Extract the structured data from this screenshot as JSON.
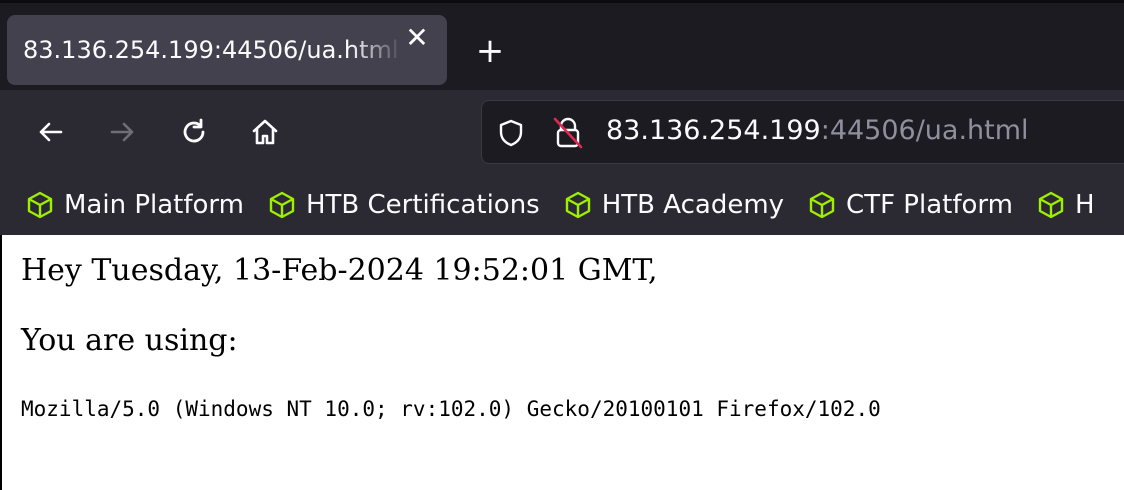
{
  "tabs": [
    {
      "title": "83.136.254.199:44506/ua.html",
      "close_icon": "close-icon"
    }
  ],
  "new_tab": {
    "label": "+",
    "icon": "plus-icon"
  },
  "navigation": {
    "back_icon": "arrow-left-icon",
    "forward_icon": "arrow-right-icon",
    "reload_icon": "reload-icon",
    "home_icon": "home-icon"
  },
  "urlbar": {
    "host": "83.136.254.199",
    "rest": ":44506/ua.html",
    "shield_icon": "shield-icon",
    "insecure_icon": "insecure-lock-icon"
  },
  "bookmarks": [
    {
      "label": "Main Platform",
      "icon": "cube-icon"
    },
    {
      "label": "HTB Certifications",
      "icon": "cube-icon"
    },
    {
      "label": "HTB Academy",
      "icon": "cube-icon"
    },
    {
      "label": "CTF Platform",
      "icon": "cube-icon"
    },
    {
      "label": "H",
      "icon": "cube-icon"
    }
  ],
  "page": {
    "greeting": "Hey Tuesday, 13-Feb-2024 19:52:01 GMT,",
    "using_label": "You are using:",
    "user_agent": "Mozilla/5.0 (Windows NT 10.0; rv:102.0) Gecko/20100101 Firefox/102.0"
  },
  "colors": {
    "tabbar_bg": "#1c1b22",
    "toolbar_bg": "#2b2a33",
    "active_tab": "#42414d",
    "bookmark_icon": "#9fef00",
    "insecure_slash": "#e22850"
  }
}
